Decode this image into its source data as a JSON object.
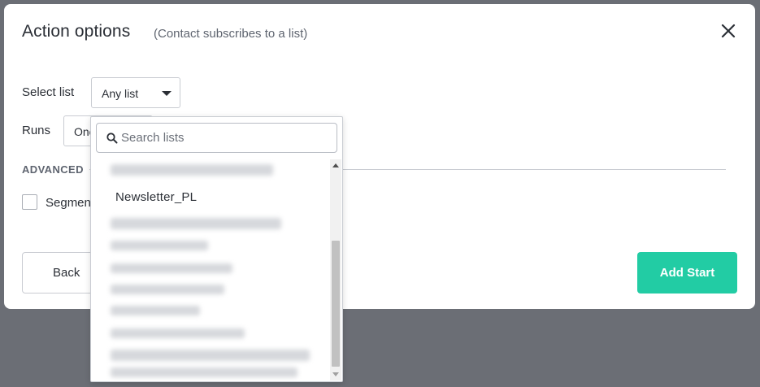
{
  "modal": {
    "title": "Action options",
    "subtitle": "(Contact subscribes to a list)",
    "close_icon": "close-icon"
  },
  "form": {
    "select_list_label": "Select list",
    "select_list_value": "Any list",
    "runs_label": "Runs",
    "runs_value": "Onc",
    "advanced_label": "ADVANCED",
    "segment_label": "Segmen"
  },
  "dropdown": {
    "search_placeholder": "Search lists",
    "search_icon": "search-icon",
    "visible_item": "Newsletter_PL",
    "scroll_position": "bottom"
  },
  "buttons": {
    "back": "Back",
    "add_start": "Add Start"
  },
  "colors": {
    "overlay": "#6b6e75",
    "primary": "#22cca4",
    "text": "#2b2f36"
  }
}
